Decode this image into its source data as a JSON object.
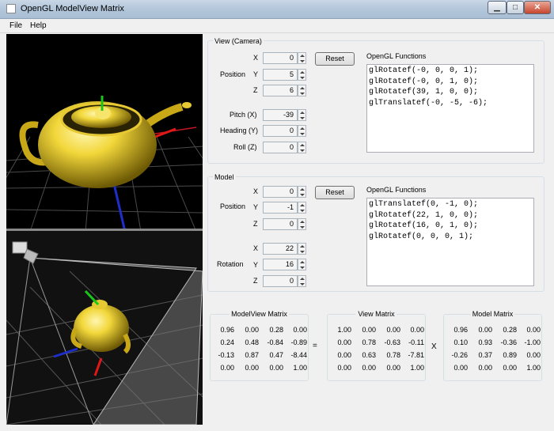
{
  "window": {
    "title": "OpenGL ModelView Matrix",
    "buttons": [
      "▁",
      "□",
      "✕"
    ]
  },
  "menu": [
    "File",
    "Help"
  ],
  "view": {
    "title": "View (Camera)",
    "position_label": "Position",
    "axes": [
      "X",
      "Y",
      "Z"
    ],
    "position": [
      "0",
      "5",
      "6"
    ],
    "reset": "Reset",
    "pitch_label": "Pitch (X)",
    "pitch": "-39",
    "heading_label": "Heading (Y)",
    "heading": "0",
    "roll_label": "Roll (Z)",
    "roll": "0",
    "functions_label": "OpenGL Functions",
    "code": "glRotatef(-0, 0, 0, 1);\nglRotatef(-0, 0, 1, 0);\nglRotatef(39, 1, 0, 0);\nglTranslatef(-0, -5, -6);"
  },
  "model": {
    "title": "Model",
    "position_label": "Position",
    "rotation_label": "Rotation",
    "axes": [
      "X",
      "Y",
      "Z"
    ],
    "position": [
      "0",
      "-1",
      "0"
    ],
    "rotation": [
      "22",
      "16",
      "0"
    ],
    "reset": "Reset",
    "functions_label": "OpenGL Functions",
    "code": "glTranslatef(0, -1, 0);\nglRotatef(22, 1, 0, 0);\nglRotatef(16, 0, 1, 0);\nglRotatef(0, 0, 0, 1);"
  },
  "matrices": {
    "modelview": {
      "title": "ModelView Matrix",
      "rows": [
        [
          "0.96",
          "0.00",
          "0.28",
          "0.00"
        ],
        [
          "0.24",
          "0.48",
          "-0.84",
          "-0.89"
        ],
        [
          "-0.13",
          "0.87",
          "0.47",
          "-8.44"
        ],
        [
          "0.00",
          "0.00",
          "0.00",
          "1.00"
        ]
      ]
    },
    "view": {
      "title": "View Matrix",
      "rows": [
        [
          "1.00",
          "0.00",
          "0.00",
          "0.00"
        ],
        [
          "0.00",
          "0.78",
          "-0.63",
          "-0.11"
        ],
        [
          "0.00",
          "0.63",
          "0.78",
          "-7.81"
        ],
        [
          "0.00",
          "0.00",
          "0.00",
          "1.00"
        ]
      ]
    },
    "model": {
      "title": "Model Matrix",
      "rows": [
        [
          "0.96",
          "0.00",
          "0.28",
          "0.00"
        ],
        [
          "0.10",
          "0.93",
          "-0.36",
          "-1.00"
        ],
        [
          "-0.26",
          "0.37",
          "0.89",
          "0.00"
        ],
        [
          "0.00",
          "0.00",
          "0.00",
          "1.00"
        ]
      ]
    },
    "equals": "=",
    "times": "X"
  }
}
